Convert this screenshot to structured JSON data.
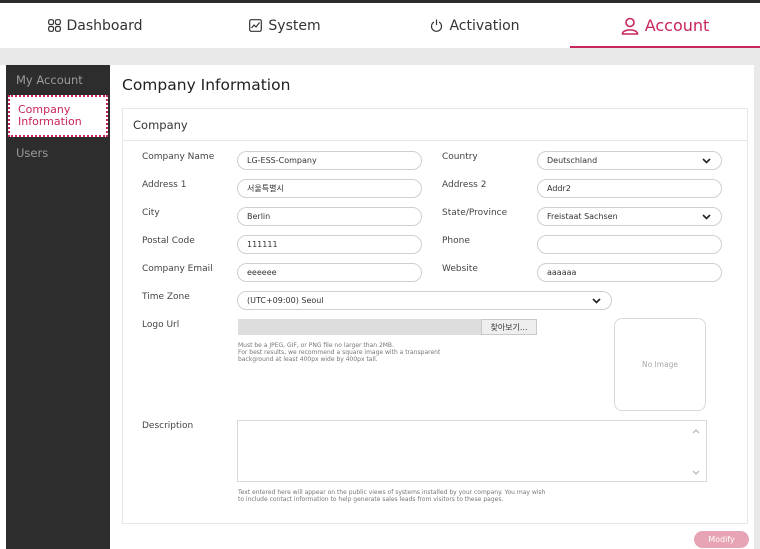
{
  "nav": {
    "tabs": [
      {
        "label": "Dashboard",
        "icon": "grid-icon"
      },
      {
        "label": "System",
        "icon": "chart-icon"
      },
      {
        "label": "Activation",
        "icon": "power-icon"
      },
      {
        "label": "Account",
        "icon": "user-icon"
      }
    ],
    "active": "Account"
  },
  "sidebar": {
    "heading": "My Account",
    "items": [
      {
        "label_line1": "Company",
        "label_line2": "Information"
      },
      {
        "label": "Users"
      }
    ]
  },
  "page": {
    "title": "Company Information",
    "panel_title": "Company"
  },
  "form": {
    "company_name": {
      "label": "Company Name",
      "value": "LG-ESS-Company"
    },
    "country": {
      "label": "Country",
      "value": "Deutschland"
    },
    "address1": {
      "label": "Address 1",
      "value": "서울특별시"
    },
    "address2": {
      "label": "Address 2",
      "value": "Addr2"
    },
    "city": {
      "label": "City",
      "value": "Berlin"
    },
    "state": {
      "label": "State/Province",
      "value": "Freistaat Sachsen"
    },
    "postal_code": {
      "label": "Postal Code",
      "value": "111111"
    },
    "phone": {
      "label": "Phone",
      "value": ""
    },
    "company_email": {
      "label": "Company Email",
      "value": "eeeeee"
    },
    "website": {
      "label": "Website",
      "value": "aaaaaa"
    },
    "time_zone": {
      "label": "Time Zone",
      "value": "(UTC+09:00) Seoul"
    },
    "logo_url": {
      "label": "Logo Url",
      "browse_label": "찾아보기...",
      "help_line1": "Must be a JPEG, GIF, or PNG file no larger than 2MB.",
      "help_line2": "For best results, we recommend a square image with a transparent",
      "help_line3": "background at least 400px wide by 400px tall.",
      "no_image": "No Image"
    },
    "description": {
      "label": "Description",
      "value": "",
      "help_line1": "Text entered here will appear on the public views of systems installed by your company. You may wish",
      "help_line2": "to include contact information to help generate sales leads from visitors to these pages."
    }
  },
  "actions": {
    "modify_label": "Modify"
  },
  "colors": {
    "accent": "#c8255a",
    "sidebar_bg": "#2d2d2d",
    "modify_bg": "#e7a4b5"
  }
}
